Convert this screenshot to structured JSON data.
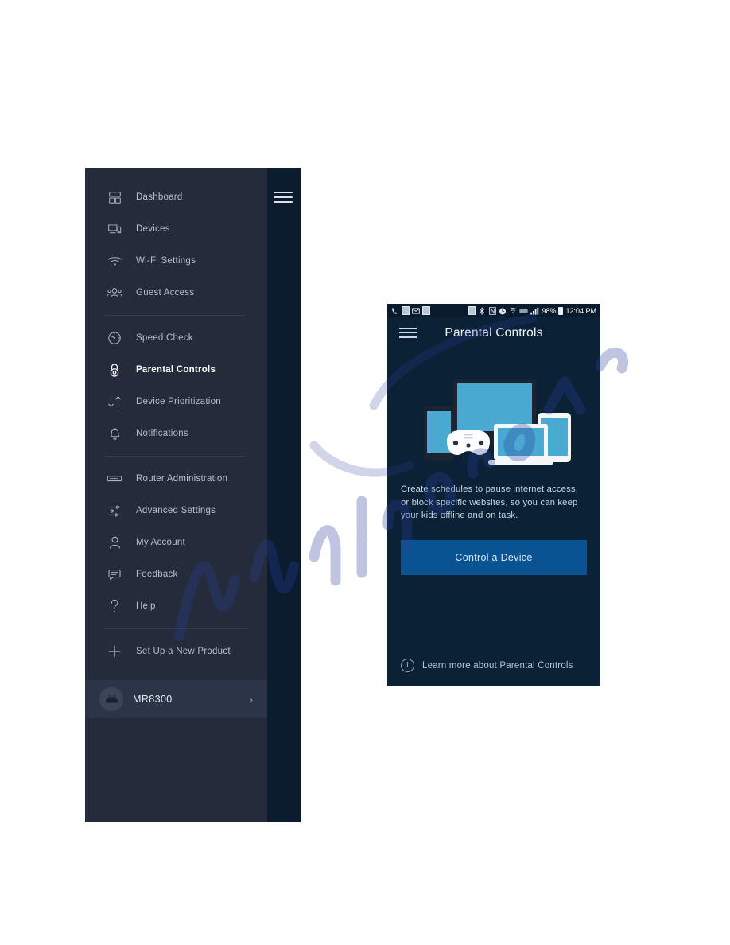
{
  "sidebar": {
    "hamburger_icon": "hamburger-menu-icon",
    "groups": [
      {
        "items": [
          {
            "label": "Dashboard",
            "icon": "dashboard-icon",
            "active": false
          },
          {
            "label": "Devices",
            "icon": "devices-icon",
            "active": false
          },
          {
            "label": "Wi-Fi Settings",
            "icon": "wifi-icon",
            "active": false
          },
          {
            "label": "Guest Access",
            "icon": "guest-access-icon",
            "active": false
          }
        ]
      },
      {
        "items": [
          {
            "label": "Speed Check",
            "icon": "speedometer-icon",
            "active": false
          },
          {
            "label": "Parental Controls",
            "icon": "lock-icon",
            "active": true
          },
          {
            "label": "Device Prioritization",
            "icon": "up-down-arrows-icon",
            "active": false
          },
          {
            "label": "Notifications",
            "icon": "bell-icon",
            "active": false
          }
        ]
      },
      {
        "items": [
          {
            "label": "Router Administration",
            "icon": "router-icon",
            "active": false
          },
          {
            "label": "Advanced Settings",
            "icon": "sliders-icon",
            "active": false
          },
          {
            "label": "My Account",
            "icon": "user-icon",
            "active": false
          },
          {
            "label": "Feedback",
            "icon": "chat-bubble-icon",
            "active": false
          },
          {
            "label": "Help",
            "icon": "question-mark-icon",
            "active": false
          }
        ]
      },
      {
        "items": [
          {
            "label": "Set Up a New Product",
            "icon": "plus-icon",
            "active": false
          }
        ]
      }
    ],
    "router": {
      "name": "MR8300",
      "avatar_icon": "router-device-icon",
      "chevron_icon": "chevron-right-icon"
    }
  },
  "phone": {
    "statusbar": {
      "left_icons": [
        "phone-missed-icon",
        "calendar-icon",
        "mail-icon",
        "messages-icon"
      ],
      "right_icons": [
        "vibrate-icon",
        "bluetooth-icon",
        "nfc-icon",
        "alarm-icon",
        "wifi-icon",
        "hd-voice-icon",
        "signal-bars-icon"
      ],
      "battery_percent": "98%",
      "battery_icon": "battery-full-icon",
      "time": "12:04 PM"
    },
    "appbar": {
      "menu_icon": "hamburger-menu-icon",
      "title": "Parental Controls"
    },
    "illustration": {
      "name": "devices-illustration",
      "devices": [
        "tv",
        "smartphone",
        "game-controller",
        "laptop",
        "tablet",
        "phone"
      ]
    },
    "description": "Create schedules to pause internet access, or block specific websites, so you can keep your kids offline and on task.",
    "cta_label": "Control a Device",
    "learn_more": {
      "icon": "info-icon",
      "label": "Learn more about Parental Controls"
    }
  },
  "colors": {
    "sidebar_bg": "#242c3c",
    "sidebar_dark_strip": "#0a1c2e",
    "phone_bg": "#0a2136",
    "statusbar_bg": "#081a2b",
    "cta_blue": "#0a5393",
    "label_gray": "#b7bfcc",
    "active_white": "#ffffff",
    "screen_teal": "#4aa8cf"
  }
}
